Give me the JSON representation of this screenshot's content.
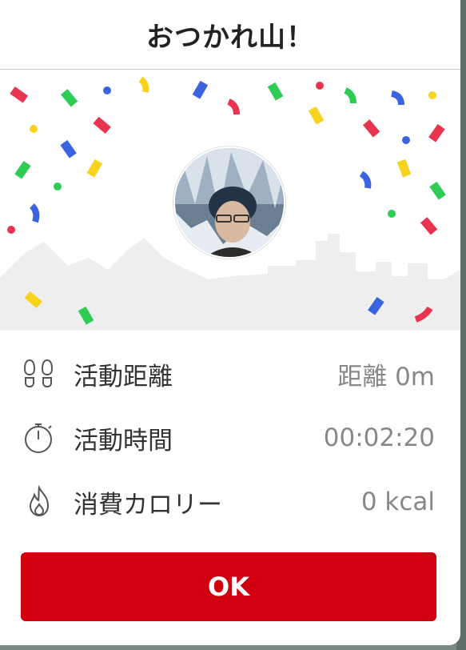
{
  "dialog": {
    "title": "おつかれ山！",
    "ok_label": "OK"
  },
  "stats": [
    {
      "icon": "footprints-icon",
      "label": "活動距離",
      "value": "距離 0m"
    },
    {
      "icon": "stopwatch-icon",
      "label": "活動時間",
      "value": "00:02:20"
    },
    {
      "icon": "flame-icon",
      "label": "消費カロリー",
      "value": "0 kcal"
    }
  ],
  "colors": {
    "accent": "#d0000f",
    "confetti": [
      "#e8344e",
      "#f7d21e",
      "#3b63e0",
      "#2ecc55"
    ]
  }
}
